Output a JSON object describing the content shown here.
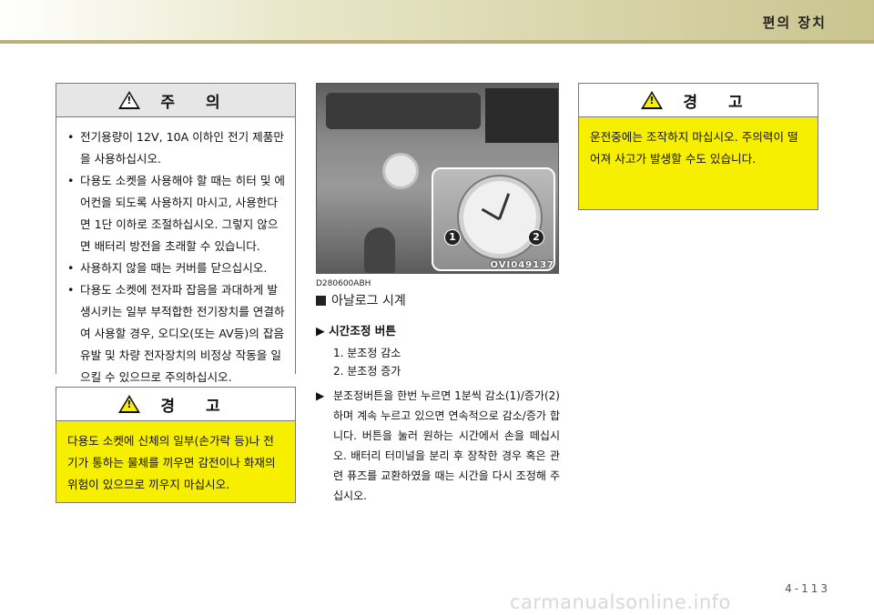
{
  "header": {
    "section_title": "편의 장치"
  },
  "caution_box": {
    "title": "주 의",
    "items": [
      "전기용량이 12V, 10A 이하인 전기 제품만을 사용하십시오.",
      "다용도 소켓을 사용해야 할 때는 히터 및 에어컨을 되도록 사용하지 마시고, 사용한다면 1단 이하로 조절하십시오. 그렇지 않으면 배터리 방전을 초래할 수 있습니다.",
      "사용하지 않을 때는 커버를 닫으십시오.",
      "다용도 소켓에 전자파 잡음을 과대하게 발생시키는 일부 부적합한 전기장치를 연결하여 사용할 경우, 오디오(또는 AV등)의 잡음 유발 및 차량 전자장치의 비정상 작동을 일으킬 수 있으므로 주의하십시오."
    ]
  },
  "warning_box_1": {
    "title": "경 고",
    "text": "다용도 소켓에 신체의 일부(손가락 등)나 전기가 통하는 물체를 끼우면 감전이나 화재의 위험이 있으므로 끼우지 마십시오."
  },
  "warning_box_2": {
    "title": "경 고",
    "text": "운전중에는 조작하지 마십시오. 주의력이 떨어져 사고가 발생할 수도 있습니다."
  },
  "figure": {
    "callout_1": "1",
    "callout_2": "2",
    "image_code": "OVI049137"
  },
  "section": {
    "doc_code": "D280600ABH",
    "title": "아날로그 시계",
    "subheading": "시간조정 버튼",
    "steps": [
      "1. 분조정 감소",
      "2. 분조정 증가"
    ],
    "paragraph": "분조정버튼을 한번 누르면 1분씩 감소(1)/증가(2)하며 계속 누르고 있으면 연속적으로 감소/증가 합니다. 버튼을 눌러 원하는 시간에서 손을 떼십시오. 배터리 터미널을 분리 후 장착한 경우 혹은 관련 퓨즈를 교환하였을 때는 시간을 다시 조정해 주십시오."
  },
  "footer": {
    "page_number": "4-113",
    "watermark": "carmanualsonline.info"
  }
}
